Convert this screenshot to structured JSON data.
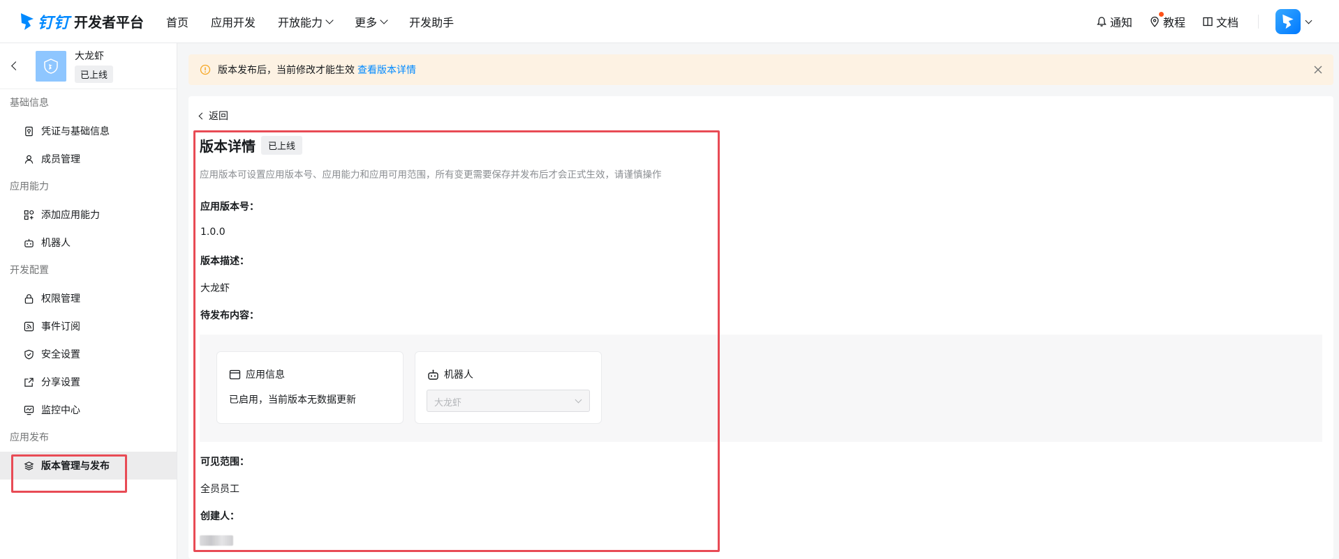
{
  "header": {
    "logo_brand": "钉钉",
    "logo_sub": "开发者平台",
    "nav": [
      {
        "label": "首页"
      },
      {
        "label": "应用开发"
      },
      {
        "label": "开放能力"
      },
      {
        "label": "更多"
      },
      {
        "label": "开发助手"
      }
    ],
    "right": {
      "notify": "通知",
      "tutorial": "教程",
      "docs": "文档"
    }
  },
  "app": {
    "name": "大龙虾",
    "status": "已上线"
  },
  "sidebar": {
    "groups": [
      {
        "title": "基础信息",
        "items": [
          {
            "label": "凭证与基础信息"
          },
          {
            "label": "成员管理"
          }
        ]
      },
      {
        "title": "应用能力",
        "items": [
          {
            "label": "添加应用能力"
          },
          {
            "label": "机器人"
          }
        ]
      },
      {
        "title": "开发配置",
        "items": [
          {
            "label": "权限管理"
          },
          {
            "label": "事件订阅"
          },
          {
            "label": "安全设置"
          },
          {
            "label": "分享设置"
          },
          {
            "label": "监控中心"
          }
        ]
      },
      {
        "title": "应用发布",
        "items": [
          {
            "label": "版本管理与发布"
          }
        ]
      }
    ]
  },
  "banner": {
    "text": "版本发布后，当前修改才能生效",
    "link": "查看版本详情"
  },
  "detail": {
    "back": "返回",
    "title": "版本详情",
    "status": "已上线",
    "description": "应用版本可设置应用版本号、应用能力和应用可用范围，所有变更需要保存并发布后才会正式生效，请谨慎操作",
    "version_label": "应用版本号：",
    "version_value": "1.0.0",
    "desc_label": "版本描述：",
    "desc_value": "大龙虾",
    "pending_label": "待发布内容：",
    "cards": {
      "app_info": {
        "title": "应用信息",
        "text": "已启用，当前版本无数据更新"
      },
      "robot": {
        "title": "机器人",
        "select_value": "大龙虾"
      }
    },
    "scope_label": "可见范围：",
    "scope_value": "全员员工",
    "creator_label": "创建人："
  },
  "colors": {
    "brand": "#0089ff",
    "highlight": "#e84b55",
    "banner_bg": "#fdf2e3",
    "warn": "#f5a623"
  }
}
